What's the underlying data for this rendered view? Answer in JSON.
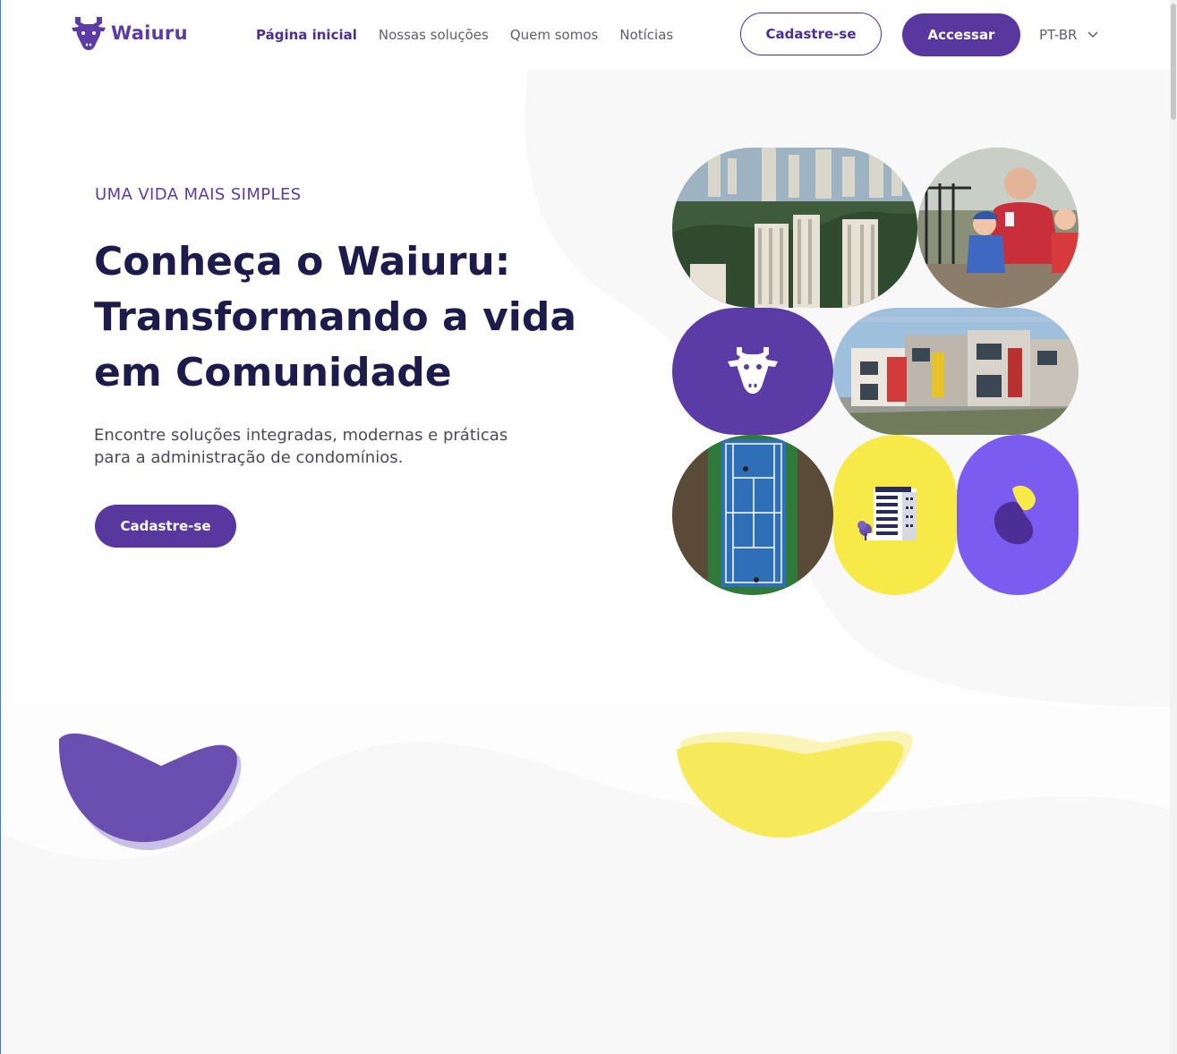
{
  "header": {
    "logo_text": "Waiuru",
    "nav": [
      {
        "label": "Página inicial",
        "active": true
      },
      {
        "label": "Nossas soluções",
        "active": false
      },
      {
        "label": "Quem somos",
        "active": false
      },
      {
        "label": "Notícias",
        "active": false
      }
    ],
    "signup_label": "Cadastre-se",
    "login_label": "Accessar",
    "language": "PT-BR"
  },
  "hero": {
    "eyebrow": "UMA VIDA MAIS SIMPLES",
    "title_line1": "Conheça o Waiuru:",
    "title_line2": "Transformando a vida",
    "title_line3": "em Comunidade",
    "subtitle_line1": "Encontre soluções integradas, modernas e práticas",
    "subtitle_line2": "para a administração de condomínios.",
    "cta_label": "Cadastre-se"
  },
  "colors": {
    "brand_purple": "#58389e",
    "dark_navy": "#1d1b4b",
    "accent_yellow": "#f7ea48",
    "light_purple": "#7a5cf0",
    "bg_gray": "#f8f8f8"
  }
}
